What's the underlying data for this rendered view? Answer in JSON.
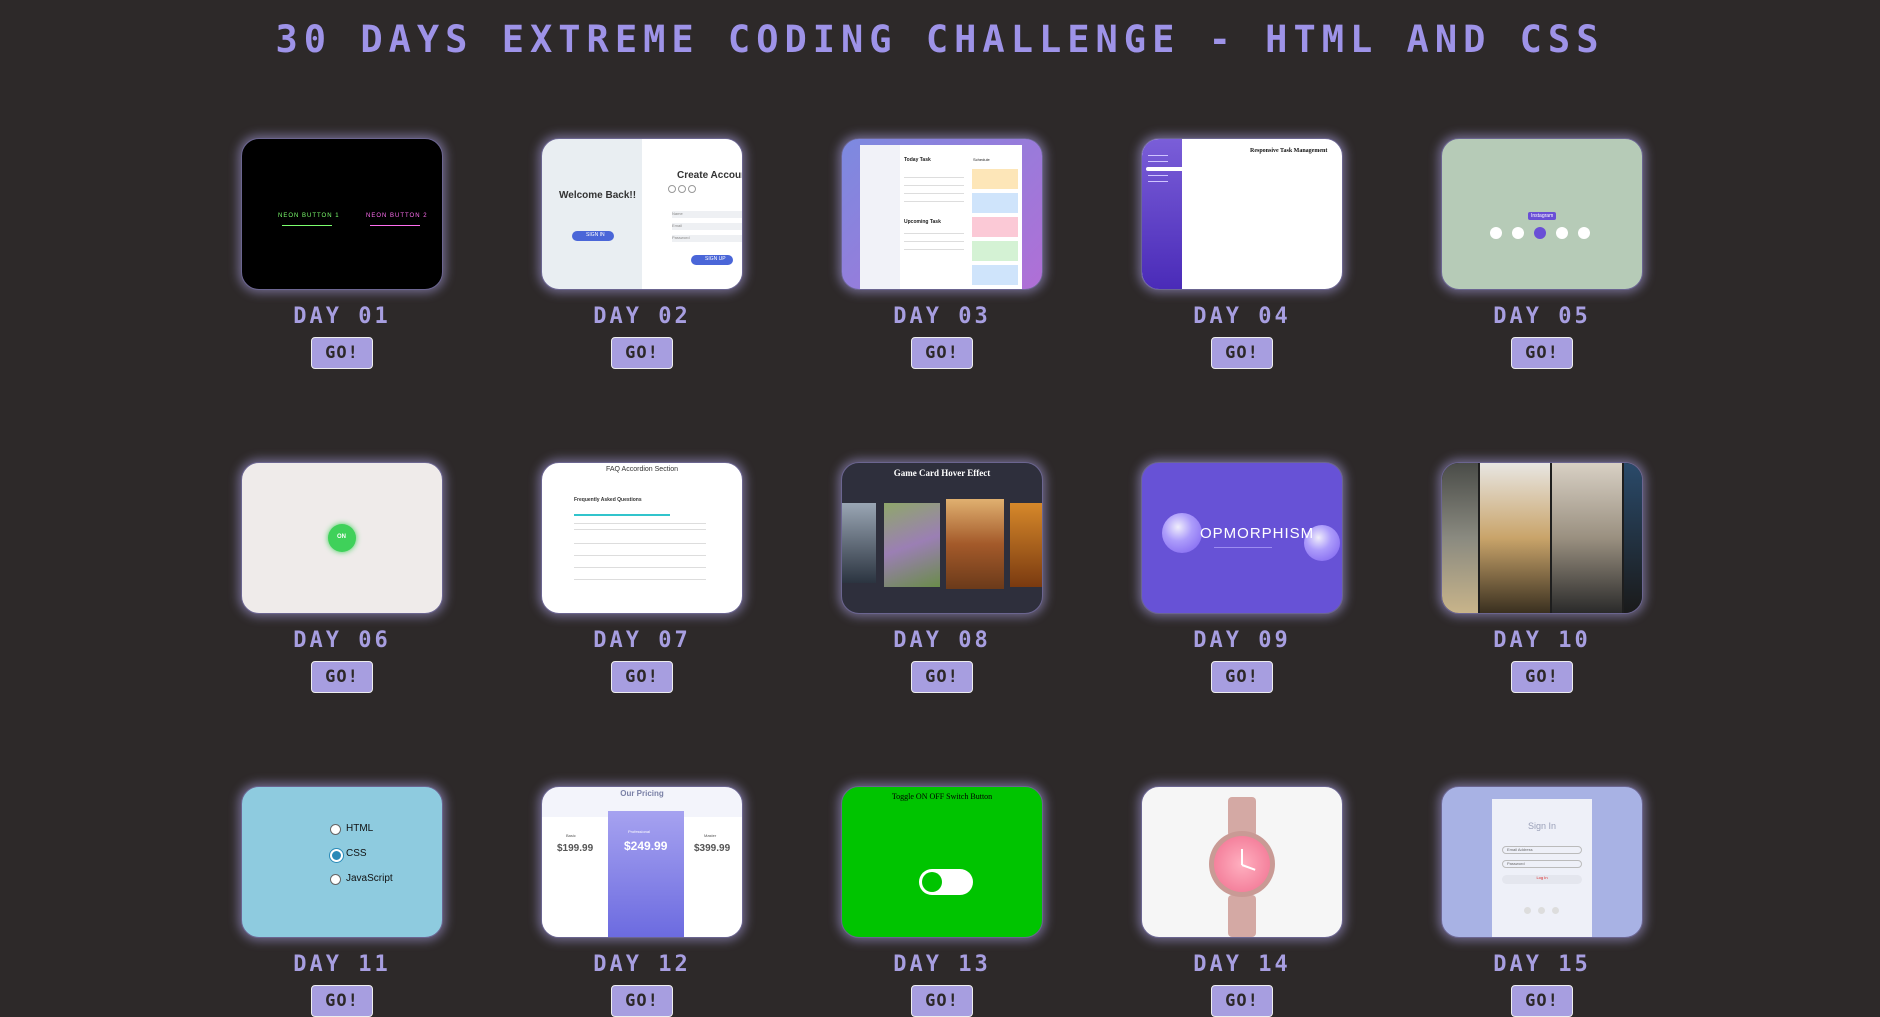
{
  "title": "30 DAYS EXTREME CODING CHALLENGE - HTML AND CSS",
  "go_label": "GO!",
  "days": [
    {
      "label": "DAY 01"
    },
    {
      "label": "DAY 02"
    },
    {
      "label": "DAY 03"
    },
    {
      "label": "DAY 04"
    },
    {
      "label": "DAY 05"
    },
    {
      "label": "DAY 06"
    },
    {
      "label": "DAY 07"
    },
    {
      "label": "DAY 08"
    },
    {
      "label": "DAY 09"
    },
    {
      "label": "DAY 10"
    },
    {
      "label": "DAY 11"
    },
    {
      "label": "DAY 12"
    },
    {
      "label": "DAY 13"
    },
    {
      "label": "DAY 14"
    },
    {
      "label": "DAY 15"
    }
  ],
  "previews": {
    "d1": {
      "btn1": "NEON BUTTON 1",
      "btn2": "NEON BUTTON 2"
    },
    "d2": {
      "welcome": "Welcome Back!!",
      "create": "Create Account",
      "signin": "SIGN IN",
      "signup": "SIGN UP",
      "name": "Name",
      "email": "Email",
      "password": "Password"
    },
    "d3": {
      "today": "Today Task",
      "upcoming": "Upcoming Task",
      "schedule": "Schedule"
    },
    "d4": {
      "heading": "Responsive Task Management"
    },
    "d5": {
      "tooltip": "Instagram"
    },
    "d6": {
      "toggle": "ON"
    },
    "d7": {
      "title": "FAQ Accordion Section",
      "sub": "Frequently Asked Questions"
    },
    "d8": {
      "title": "Game Card Hover Effect"
    },
    "d9": {
      "text": "OPMORPHISM"
    },
    "d11": {
      "opt1": "HTML",
      "opt2": "CSS",
      "opt3": "JavaScript"
    },
    "d12": {
      "title": "Our Pricing",
      "p1": "$199.99",
      "p2": "$249.99",
      "p3": "$399.99",
      "basic": "Basic",
      "pro": "Professional",
      "master": "Master"
    },
    "d13": {
      "title": "Toggle ON OFF Switch Button"
    },
    "d15": {
      "title": "Sign In",
      "user": "Email Address",
      "pass": "Password",
      "btn": "Log In"
    }
  }
}
